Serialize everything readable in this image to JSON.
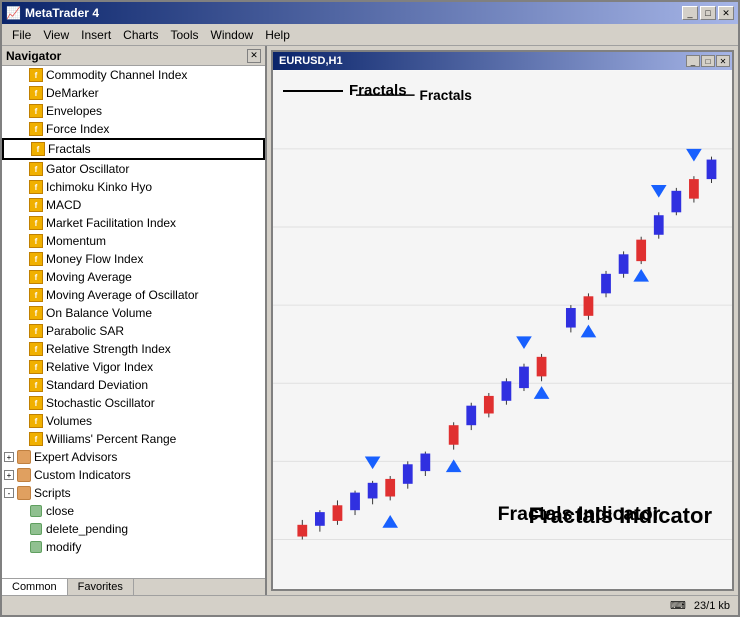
{
  "window": {
    "title": "MetaTrader 4",
    "icon": "📈"
  },
  "menu": {
    "items": [
      "File",
      "View",
      "Insert",
      "Charts",
      "Tools",
      "Window",
      "Help"
    ]
  },
  "navigator": {
    "title": "Navigator",
    "indicators": [
      "Commodity Channel Index",
      "DeMarker",
      "Envelopes",
      "Force Index",
      "Fractals",
      "Gator Oscillator",
      "Ichimoku Kinko Hyo",
      "MACD",
      "Market Facilitation Index",
      "Momentum",
      "Money Flow Index",
      "Moving Average",
      "Moving Average of Oscillator",
      "On Balance Volume",
      "Parabolic SAR",
      "Relative Strength Index",
      "Relative Vigor Index",
      "Standard Deviation",
      "Stochastic Oscillator",
      "Volumes",
      "Williams' Percent Range"
    ],
    "groups": [
      "Expert Advisors",
      "Custom Indicators",
      "Scripts"
    ],
    "scripts": [
      "close",
      "delete_pending",
      "modify"
    ],
    "tabs": [
      "Common",
      "Favorites"
    ],
    "active_tab": "Common"
  },
  "chart": {
    "title": "Fractals",
    "indicator_name": "Fractals Indicator"
  },
  "status_bar": {
    "info": "23/1 kb"
  },
  "title_buttons": {
    "minimize": "_",
    "maximize": "□",
    "close": "✕"
  }
}
